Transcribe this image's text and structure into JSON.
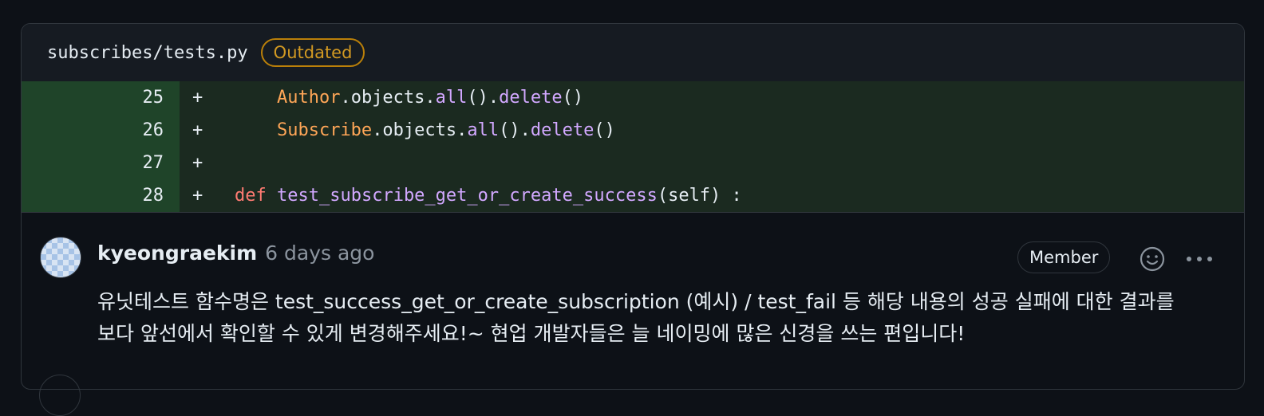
{
  "file": {
    "path": "subscribes/tests.py",
    "badge": "Outdated"
  },
  "diff": {
    "lines": [
      {
        "num": "25",
        "marker": "+",
        "indent": "       ",
        "tokens": [
          {
            "t": "Author",
            "c": "cls"
          },
          {
            "t": ".objects.",
            "c": ""
          },
          {
            "t": "all",
            "c": "fn"
          },
          {
            "t": "().",
            "c": ""
          },
          {
            "t": "delete",
            "c": "fn"
          },
          {
            "t": "()",
            "c": ""
          }
        ]
      },
      {
        "num": "26",
        "marker": "+",
        "indent": "       ",
        "tokens": [
          {
            "t": "Subscribe",
            "c": "cls"
          },
          {
            "t": ".objects.",
            "c": ""
          },
          {
            "t": "all",
            "c": "fn"
          },
          {
            "t": "().",
            "c": ""
          },
          {
            "t": "delete",
            "c": "fn"
          },
          {
            "t": "()",
            "c": ""
          }
        ]
      },
      {
        "num": "27",
        "marker": "+",
        "indent": "",
        "tokens": []
      },
      {
        "num": "28",
        "marker": "+",
        "indent": "   ",
        "tokens": [
          {
            "t": "def",
            "c": "kw"
          },
          {
            "t": " ",
            "c": ""
          },
          {
            "t": "test_subscribe_get_or_create_success",
            "c": "fn"
          },
          {
            "t": "(self) :",
            "c": ""
          }
        ]
      }
    ]
  },
  "comment": {
    "author": "kyeongraekim",
    "time": "6 days ago",
    "role_badge": "Member",
    "body_line1": "유닛테스트 함수명은 test_success_get_or_create_subscription (예시) / test_fail 등 해당 내용의 성공 실패에 대한 결과를",
    "body_line2": "보다 앞선에서 확인할 수 있게 변경해주세요!~ 현업 개발자들은 늘 네이밍에 많은 신경을 쓰는 편입니다!"
  },
  "icons": {
    "emoji": "smiley-icon",
    "more": "kebab-horizontal-icon"
  }
}
